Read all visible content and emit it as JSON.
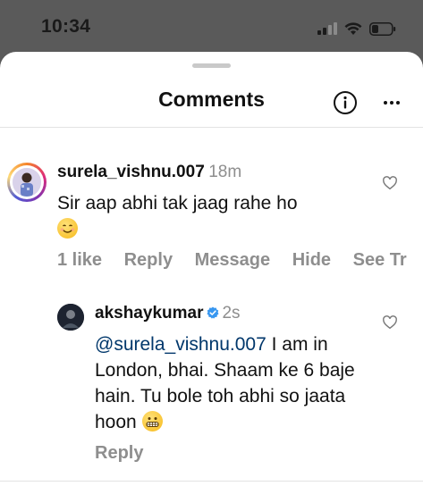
{
  "status_bar": {
    "time": "10:34",
    "icons": [
      "cellular-signal-icon",
      "wifi-icon",
      "battery-icon"
    ]
  },
  "sheet": {
    "title": "Comments",
    "info_icon": "info-icon",
    "more_icon": "more-options-icon"
  },
  "comments": [
    {
      "username": "surela_vishnu.007",
      "time": "18m",
      "text": "Sir aap abhi tak jaag rahe ho",
      "emoji": "smiling-face-emoji",
      "actions": {
        "likes": "1 like",
        "reply": "Reply",
        "message": "Message",
        "hide": "Hide",
        "see_translation": "See Tr"
      }
    },
    {
      "username": "akshaykumar",
      "verified": true,
      "time": "2s",
      "mention": "@surela_vishnu.007",
      "text": " I am in London, bhai. Shaam ke 6 baje hain. Tu bole toh abhi so jaata hoon",
      "emoji": "grimacing-face-emoji",
      "actions": {
        "reply": "Reply"
      }
    }
  ],
  "colors": {
    "status_bar_bg": "#5a5a5a",
    "mention": "#00376b",
    "verified_badge": "#3897f0",
    "secondary_text": "#8e8e8e"
  }
}
